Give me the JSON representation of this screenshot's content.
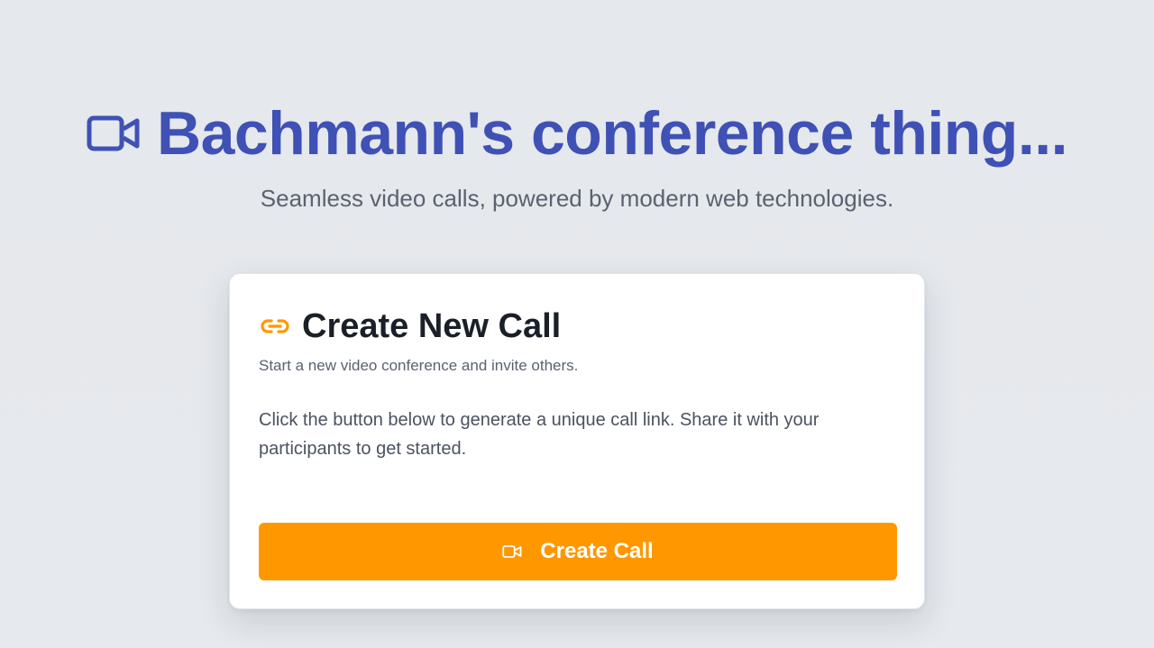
{
  "header": {
    "title": "Bachmann's conference thing...",
    "subtitle": "Seamless video calls, powered by modern web technologies.",
    "icon": "video-camera-icon",
    "accent_color": "#3f51b5"
  },
  "card": {
    "title": "Create New Call",
    "title_icon": "link-icon",
    "description": "Start a new video conference and invite others.",
    "body": "Click the button below to generate a unique call link. Share it with your participants to get started.",
    "button": {
      "label": "Create Call",
      "icon": "video-camera-icon",
      "color": "#ff9800"
    }
  }
}
